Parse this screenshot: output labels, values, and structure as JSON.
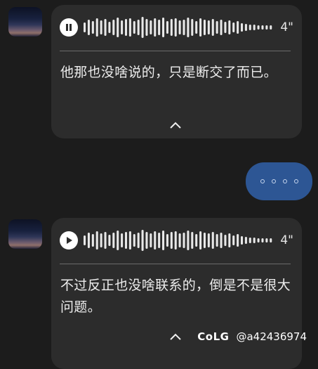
{
  "messages": [
    {
      "type": "voice",
      "play_state": "pause-icon",
      "duration": "4\"",
      "transcript": "他那也没啥说的，只是断交了而已。"
    },
    {
      "type": "sent",
      "bubble_color": "#2d5694",
      "indicator": "typing-dots"
    },
    {
      "type": "voice",
      "play_state": "play-icon",
      "duration": "4\"",
      "transcript": "不过反正也没啥联系的，倒是不是很大问题。"
    }
  ],
  "watermark": {
    "logo": "CoLG",
    "handle": "@a42436974"
  },
  "colors": {
    "background": "#1c1c1c",
    "bubble": "#2c2c2c",
    "sent_bubble": "#2d5694",
    "text": "#ededed"
  }
}
